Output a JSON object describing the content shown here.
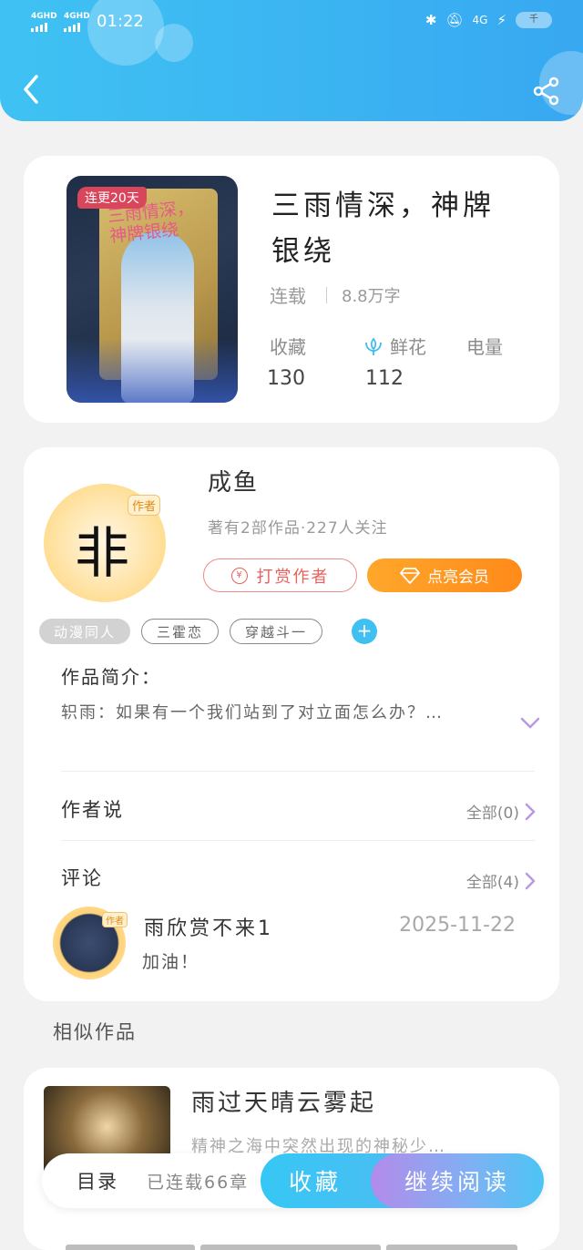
{
  "status_bar": {
    "signal1": "4GHD",
    "signal2": "4GHD",
    "time": "01:22",
    "network": "4G",
    "battery": "千"
  },
  "header": {
    "back_icon": "chevron-left-icon",
    "share_icon": "share-icon"
  },
  "book": {
    "badge": "连更20天",
    "cover_title": "三雨情深，神牌银绕",
    "title": "三雨情深，神牌银绕",
    "status": "连载",
    "words": "8.8万字",
    "stats": {
      "collect_label": "收藏",
      "collect_value": "130",
      "flower_label": "鲜花",
      "flower_value": "112",
      "power_label": "电量"
    }
  },
  "author": {
    "name": "成鱼",
    "subtitle": "著有2部作品·227人关注",
    "avatar_tag": "作者",
    "tip_label": "打赏作者",
    "vip_label": "点亮会员"
  },
  "tags": [
    "动漫同人",
    "三霍恋",
    "穿越斗一"
  ],
  "intro": {
    "label": "作品简介：",
    "text": "轵雨：如果有一个我们站到了对立面怎么办？…"
  },
  "author_says": {
    "label": "作者说",
    "more": "全部(0)"
  },
  "comments": {
    "label": "评论",
    "more": "全部(4)",
    "items": [
      {
        "user": "雨欣赏不来1",
        "date": "2025-11-22",
        "text": "加油！",
        "avatar_tag": "作者"
      }
    ]
  },
  "similar": {
    "label": "相似作品",
    "items": [
      {
        "title": "雨过天晴云雾起",
        "desc": "精神之海中突然出现的神秘少…"
      }
    ]
  },
  "bottom_bar": {
    "toc": "目录",
    "chapters": "已连载66章",
    "collect": "收藏",
    "continue": "继续阅读"
  },
  "colors": {
    "header": "#3fc2f3",
    "accent_blue": "#3fc0f0",
    "vip_orange": "#ff8a1a",
    "tip_red": "#e7625e"
  }
}
